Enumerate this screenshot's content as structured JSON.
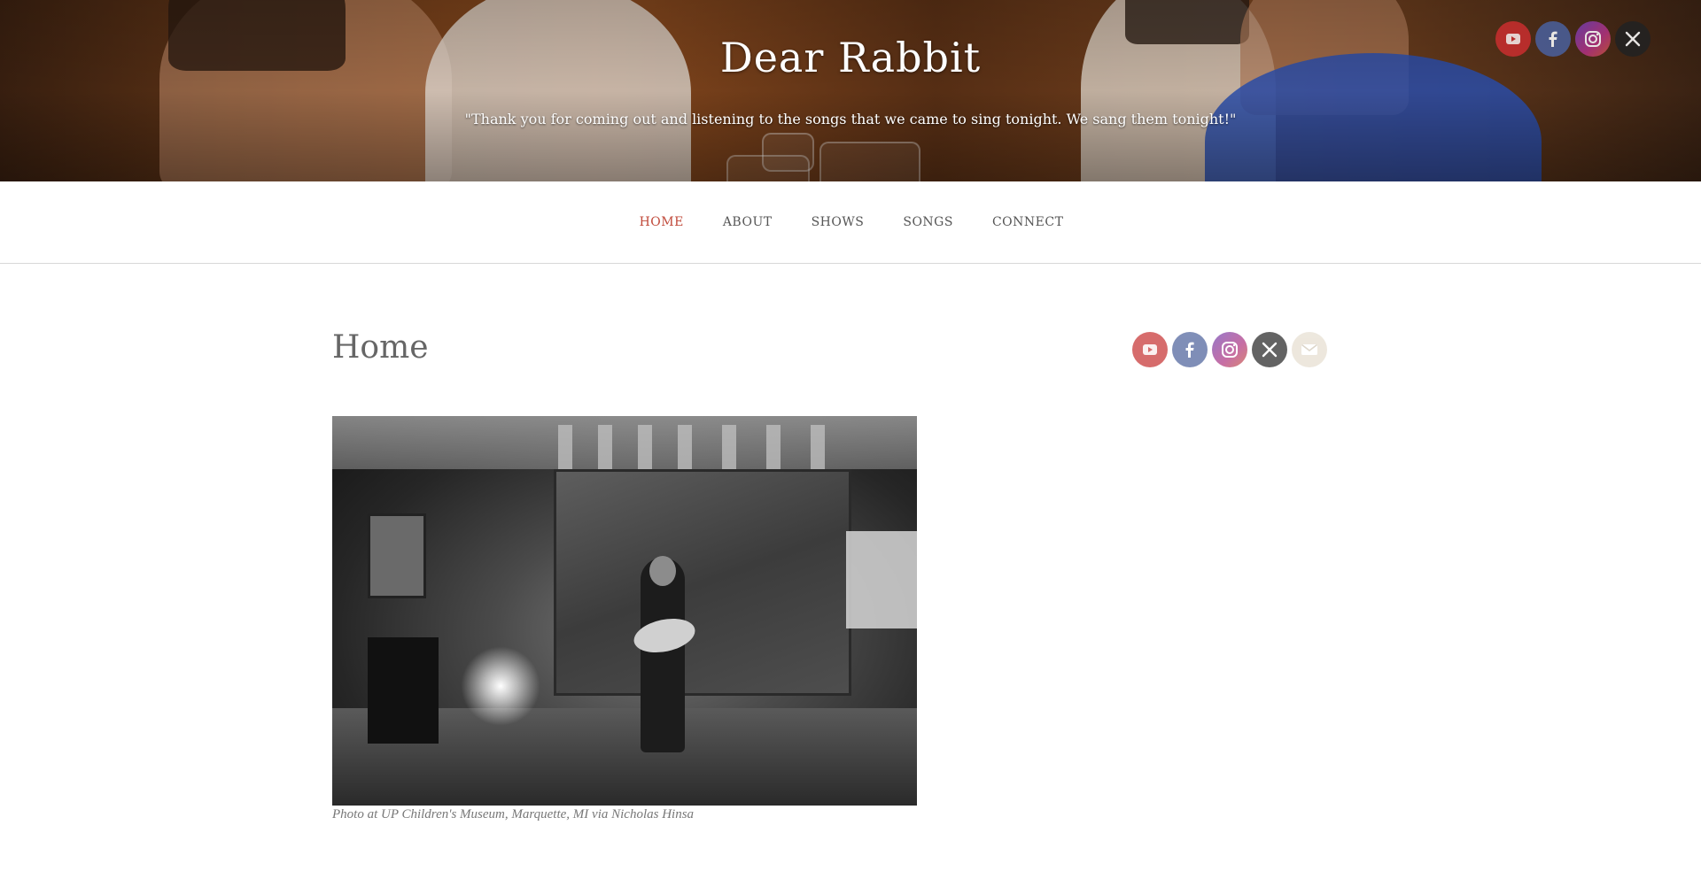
{
  "header": {
    "site_title": "Dear Rabbit",
    "tagline": "\"Thank you for coming out and listening to the songs that we came to sing tonight. We sang them tonight!\""
  },
  "header_social": [
    {
      "icon": "youtube-icon",
      "color": "#c62e2e"
    },
    {
      "icon": "facebook-icon",
      "color": "#4a5f9a"
    },
    {
      "icon": "instagram-icon",
      "color": "#b0327e"
    },
    {
      "icon": "x-icon",
      "color": "#222222"
    }
  ],
  "nav": {
    "items": [
      {
        "label": "HOME",
        "active": true
      },
      {
        "label": "ABOUT",
        "active": false
      },
      {
        "label": "SHOWS",
        "active": false
      },
      {
        "label": "SONGS",
        "active": false
      },
      {
        "label": "CONNECT",
        "active": false
      }
    ],
    "active_color": "#c0493a"
  },
  "main": {
    "page_title": "Home",
    "photo_caption": "Photo at UP Children's Museum, Marquette, MI via Nicholas Hinsa"
  },
  "sidebar_social": [
    {
      "icon": "youtube-icon",
      "color": "#c62e2e"
    },
    {
      "icon": "facebook-icon",
      "color": "#4a5f9a"
    },
    {
      "icon": "instagram-icon",
      "color": "#b0327e"
    },
    {
      "icon": "x-icon",
      "color": "#222222"
    },
    {
      "icon": "email-icon",
      "color": "#e6ded0"
    }
  ]
}
